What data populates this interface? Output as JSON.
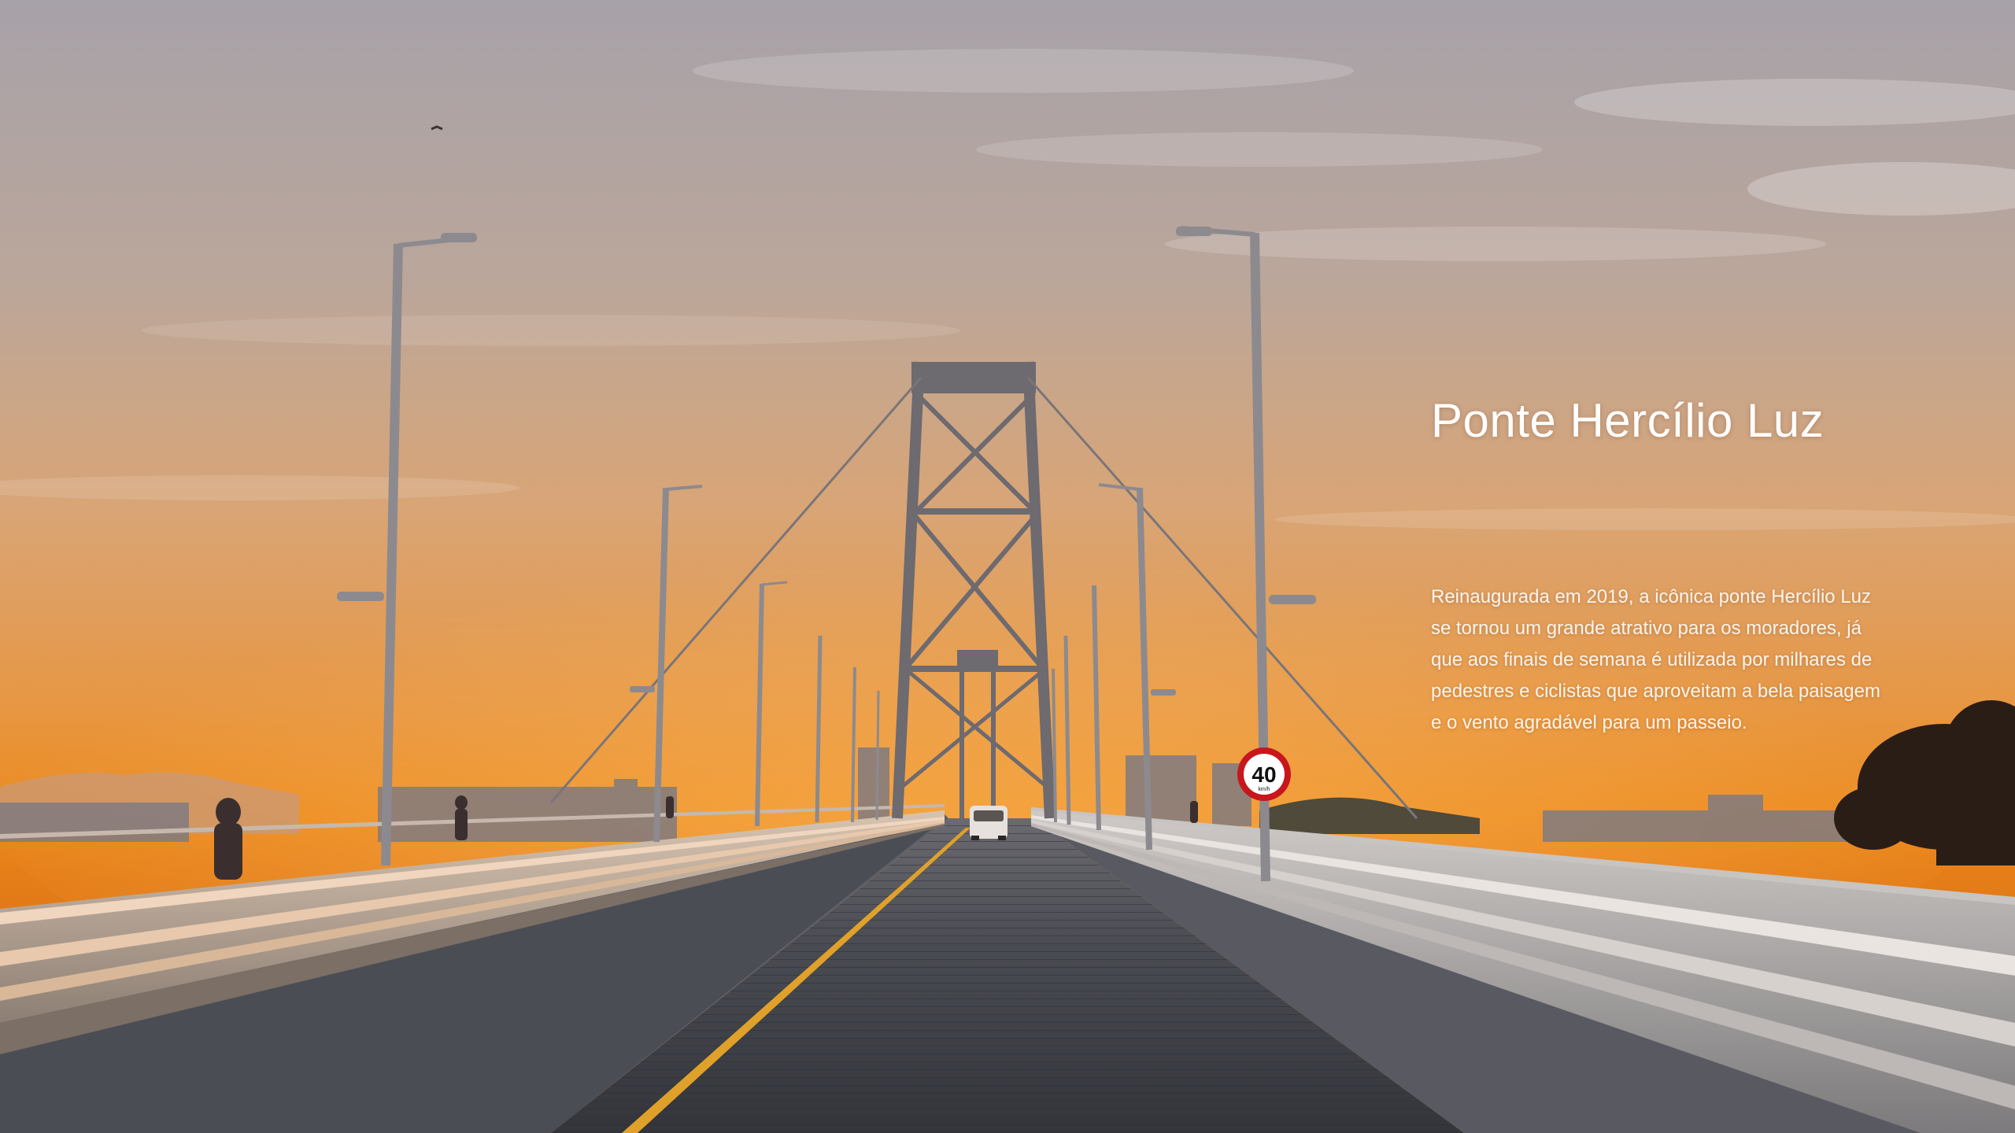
{
  "slide": {
    "title": "Ponte Hercílio Luz",
    "body": "Reinaugurada em 2019, a icônica ponte Hercílio Luz se tornou um grande atrativo para os moradores, já que aos finais de semana é utilizada por milhares de pedestres e ciclistas que aproveitam a bela paisagem e o vento agradável para um passeio."
  },
  "photo": {
    "speed_sign_value": "40",
    "speed_sign_unit": "km/h"
  },
  "colors": {
    "sky_top": "#a9a3a8",
    "sky_horizon": "#ea8a1f",
    "deck": "#3f4148",
    "steel": "#6f6c70",
    "sign_ring": "#c8161d",
    "text": "#ffffff"
  }
}
